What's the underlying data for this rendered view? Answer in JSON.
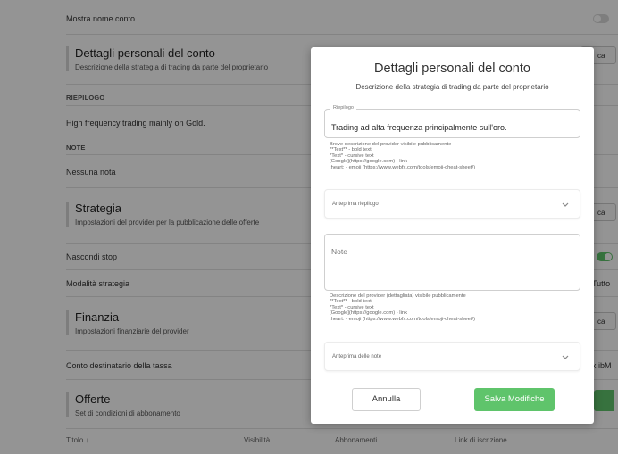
{
  "background": {
    "show_account_name": "Mostra nome conto",
    "personal_details": {
      "title": "Dettagli personali del conto",
      "subtitle": "Descrizione della strategia di trading da parte del proprietario"
    },
    "summary_header": "RIEPILOGO",
    "summary_value": "High frequency trading mainly on Gold.",
    "notes_header": "NOTE",
    "notes_value": "Nessuna nota",
    "strategy": {
      "title": "Strategia",
      "subtitle": "Impostazioni del provider per la pubblicazione delle offerte"
    },
    "hide_stop": "Nascondi stop",
    "strategy_mode": "Modalità strategia",
    "finance": {
      "title": "Finanzia",
      "subtitle": "Impostazioni finanziarie del provider"
    },
    "fee_account": "Conto destinatario della tassa",
    "offers": {
      "title": "Offerte",
      "subtitle": "Set di condizioni di abbonamento"
    },
    "table_headers": [
      "Titolo ↓",
      "Visibilità",
      "Abbonamenti",
      "Link di iscrizione"
    ],
    "right_edge": {
      "edit_1": "ca",
      "edit_2": "ca",
      "edit_3": "ca",
      "mode_value": "Tutto",
      "fee_value": "x ibM"
    },
    "toggle_colors": {
      "off": "#d9d9d9",
      "on": "#5fc46b"
    }
  },
  "modal": {
    "title": "Dettagli personali del conto",
    "subtitle": "Descrizione della strategia di trading da parte del proprietario",
    "summary_field": {
      "legend": "Riepilogo",
      "value": "Trading ad alta frequenza principalmente sull'oro."
    },
    "summary_help": [
      "Breve descrizione del provider visibile pubblicamente",
      "**Text** - bold text",
      "*Text* - cursive text",
      "[Google](https://google.com) - link",
      ":heart: - emoji (https://www.webfx.com/tools/emoji-cheat-sheet/)"
    ],
    "summary_preview": "Anteprima riepilogo",
    "notes_field": {
      "placeholder": "Note"
    },
    "notes_help": [
      "Descrizione del provider (dettagliata) visibile pubblicamente",
      "**Text** - bold text",
      "*Text* - cursive text",
      "[Google](https://google.com) - link",
      ":heart: - emoji (https://www.webfx.com/tools/emoji-cheat-sheet/)"
    ],
    "notes_preview": "Anteprima delle note",
    "cancel_label": "Annulla",
    "save_label": "Salva Modifiche",
    "save_color": "#5fc46b"
  }
}
